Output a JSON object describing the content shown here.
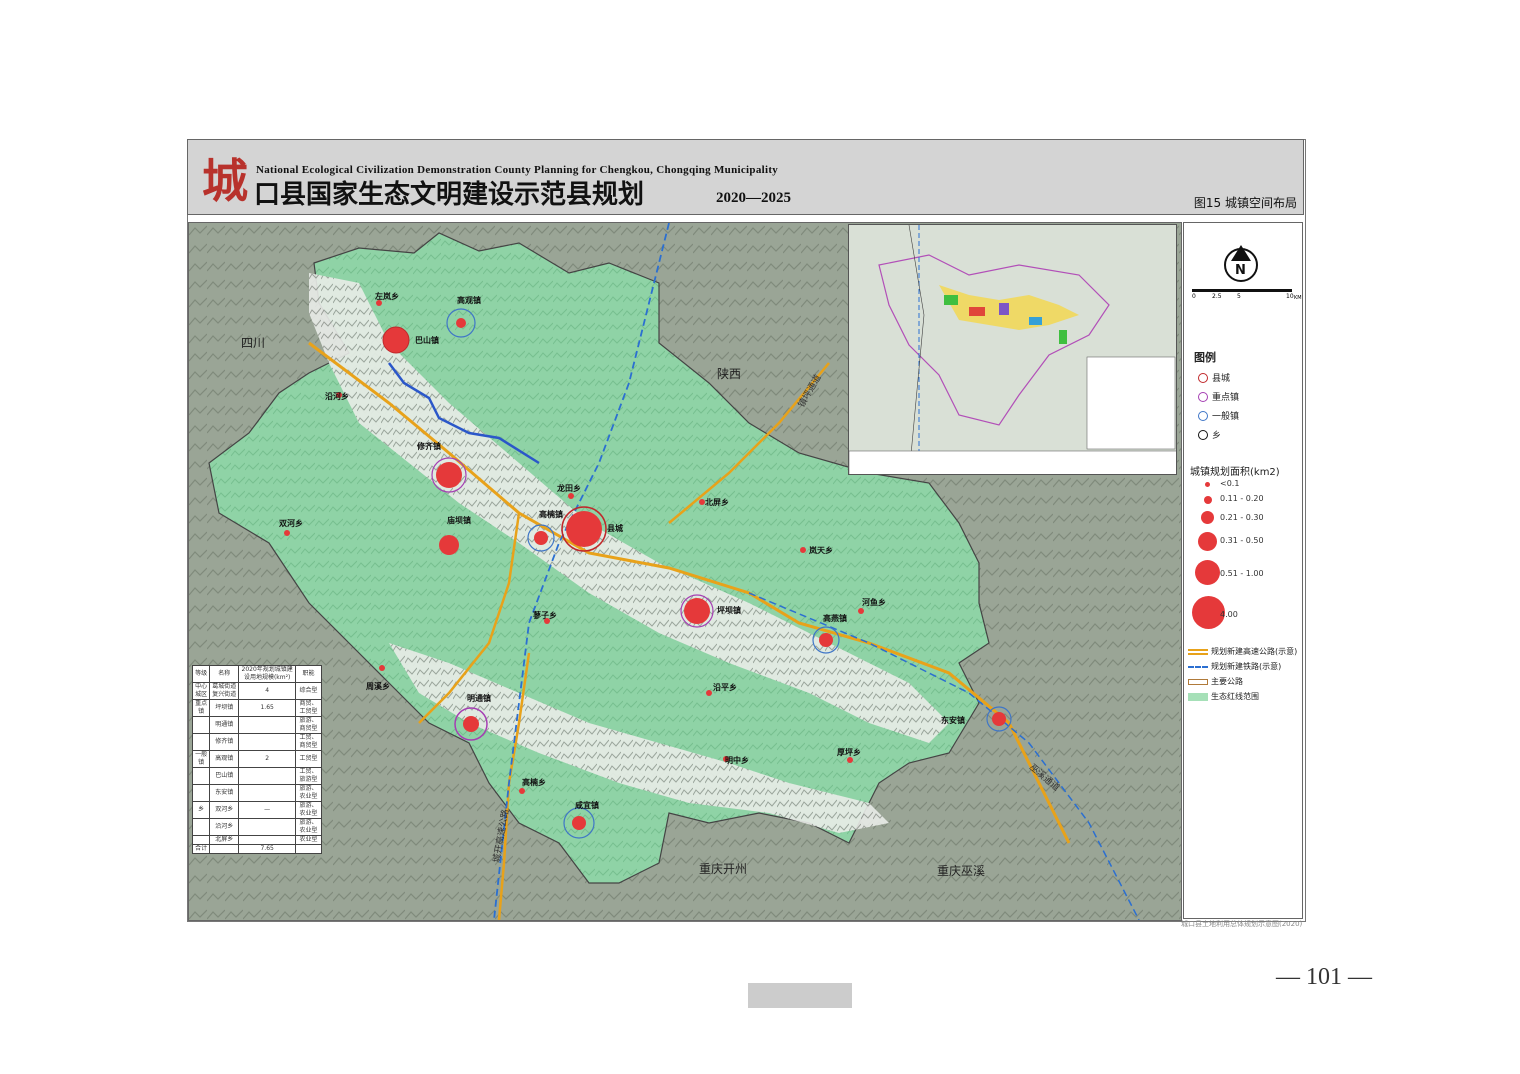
{
  "header": {
    "title_char": "城",
    "title_en": "National Ecological Civilization Demonstration County Planning for Chengkou, Chongqing Municipality",
    "title_cn": "口县国家生态文明建设示范县规划",
    "years": "2020—2025",
    "figure_label": "图15  城镇空间布局"
  },
  "map": {
    "neighbors": [
      {
        "id": "sichuan",
        "label": "四川"
      },
      {
        "id": "shaanxi",
        "label": "陕西"
      },
      {
        "id": "kaizhou",
        "label": "重庆开州"
      },
      {
        "id": "wuxi",
        "label": "重庆巫溪"
      }
    ],
    "road_labels": [
      {
        "id": "ankang",
        "label": "镇坪通道"
      },
      {
        "id": "wuxi-road",
        "label": "巫溪通道"
      },
      {
        "id": "kaizhou-road",
        "label": "城开高速公路"
      }
    ],
    "places": [
      {
        "id": "zuolan",
        "label": "左岚乡",
        "class": "xiang"
      },
      {
        "id": "gaoguan",
        "label": "高观镇",
        "class": "general"
      },
      {
        "id": "bashan",
        "label": "巴山镇",
        "class": "general"
      },
      {
        "id": "beiliang",
        "label": "北屏乡",
        "class": "xiang"
      },
      {
        "id": "zhouxi",
        "label": "沿河乡",
        "class": "xiang"
      },
      {
        "id": "xiuqi",
        "label": "修齐镇",
        "class": "general"
      },
      {
        "id": "longtian",
        "label": "龙田乡",
        "class": "xiang"
      },
      {
        "id": "gaonan",
        "label": "高楠镇",
        "class": "general"
      },
      {
        "id": "xiancheng",
        "label": "县城",
        "class": "county"
      },
      {
        "id": "shuanghe",
        "label": "双河乡",
        "class": "xiang"
      },
      {
        "id": "gengliang",
        "label": "庙坝镇",
        "class": "general"
      },
      {
        "id": "lanying",
        "label": "岚天乡",
        "class": "xiang"
      },
      {
        "id": "kanghua",
        "label": "坪坝镇",
        "class": "key"
      },
      {
        "id": "gaoyan",
        "label": "高燕镇",
        "class": "general"
      },
      {
        "id": "heyu",
        "label": "河鱼乡",
        "class": "xiang"
      },
      {
        "id": "zhuzi",
        "label": "蓼子乡",
        "class": "xiang"
      },
      {
        "id": "yanping",
        "label": "沿平乡",
        "class": "xiang"
      },
      {
        "id": "zhouwan",
        "label": "周溪乡",
        "class": "xiang"
      },
      {
        "id": "mingtong",
        "label": "明通镇",
        "class": "key"
      },
      {
        "id": "dongan",
        "label": "东安镇",
        "class": "general"
      },
      {
        "id": "mingzhong",
        "label": "明中乡",
        "class": "xiang"
      },
      {
        "id": "huping",
        "label": "厚坪乡",
        "class": "xiang"
      },
      {
        "id": "gaoqiao",
        "label": "高楠乡",
        "class": "xiang"
      },
      {
        "id": "xianyi",
        "label": "咸宜镇",
        "class": "general"
      }
    ]
  },
  "legend": {
    "title": "图例",
    "types": [
      {
        "label": "县城",
        "color": "#c0282b"
      },
      {
        "label": "重点镇",
        "color": "#a53fb3"
      },
      {
        "label": "一般镇",
        "color": "#3f76c7"
      },
      {
        "label": "乡",
        "color": "#111111"
      }
    ],
    "area_title": "城镇规划面积(km2)",
    "area_classes": [
      "<0.1",
      "0.11 - 0.20",
      "0.21 - 0.30",
      "0.31 - 0.50",
      "0.51 - 1.00",
      "4.00"
    ],
    "lines": [
      {
        "label": "规划新建高速公路(示意)",
        "color": "#e8a21a"
      },
      {
        "label": "规划新建铁路(示意)",
        "color": "#2b6fd1"
      },
      {
        "label": "主要公路",
        "color": "#b07a3a"
      },
      {
        "label": "生态红线范围",
        "color": "#a6e0b8"
      }
    ],
    "scale_labels": [
      "0",
      "2.5",
      "5",
      "10"
    ],
    "scale_unit": "KM",
    "north": "N"
  },
  "table": {
    "headers": [
      "等级",
      "名称",
      "2020年规划城镇建设用地规模(km²)",
      "职能"
    ],
    "rows": [
      [
        "中心城区",
        "葛城街道 复兴街道",
        "4",
        "综合型"
      ],
      [
        "重点镇",
        "坪坝镇",
        "1.65",
        "商贸、工贸型"
      ],
      [
        "",
        "明通镇",
        "",
        "旅游、商贸型"
      ],
      [
        "",
        "修齐镇",
        "",
        "工贸、商贸型"
      ],
      [
        "一般镇",
        "高观镇",
        "2",
        "工贸型"
      ],
      [
        "",
        "巴山镇",
        "",
        "工贸、旅游型"
      ],
      [
        "",
        "东安镇",
        "",
        "旅游、农业型"
      ],
      [
        "乡",
        "双河乡",
        "—",
        "旅游、农业型"
      ],
      [
        "",
        "沿河乡",
        "",
        "旅游、农业型"
      ],
      [
        "",
        "北屏乡",
        "",
        "农业型"
      ],
      [
        "合计",
        "",
        "7.65",
        ""
      ]
    ]
  },
  "page_number": "— 101 —",
  "source_note": "城口县土地利用总体规划示意图(2020)"
}
